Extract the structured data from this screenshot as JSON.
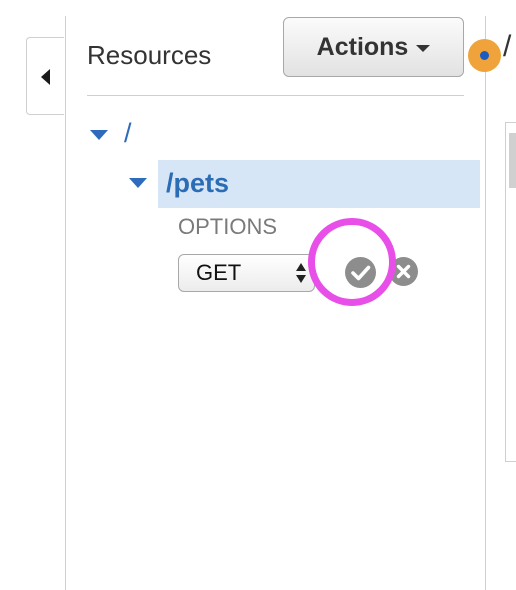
{
  "sidebar": {
    "collapse_icon": "caret-left-icon"
  },
  "header": {
    "title": "Resources",
    "actions_label": "Actions",
    "actions_icon": "caret-down-icon"
  },
  "tree": {
    "root_path": "/",
    "child_path": "/pets",
    "methods": {
      "existing": "OPTIONS",
      "new_method_selected": "GET",
      "confirm_icon": "check-circle-icon",
      "cancel_icon": "x-circle-icon"
    }
  },
  "right_panel": {
    "path_fragment": "/",
    "status_icon": "status-dot-icon"
  },
  "colors": {
    "link_blue": "#2f6bbd",
    "selected_row_bg": "#d6e6f7",
    "status_orange": "#f0a33a",
    "annotation_magenta": "#e84ee8",
    "icon_gray": "#8d8d8d"
  }
}
